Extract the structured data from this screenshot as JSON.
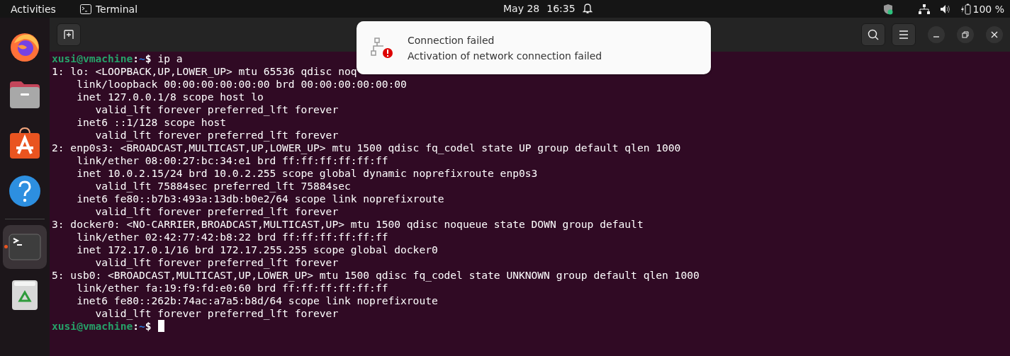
{
  "top_bar": {
    "activities": "Activities",
    "app_name": "Terminal",
    "date": "May 28",
    "time": "16:35",
    "battery": "100 %"
  },
  "dock": [
    {
      "kind": "browser",
      "running": false
    },
    {
      "kind": "files",
      "running": false
    },
    {
      "kind": "store",
      "running": false
    },
    {
      "kind": "help",
      "running": false
    },
    {
      "kind": "terminal",
      "running": true
    },
    {
      "kind": "trash",
      "running": false
    }
  ],
  "terminal": {
    "lines": [
      {
        "kind": "prompt",
        "user_host": "xusi@vmachine",
        "separator": ":",
        "path": "~",
        "symbol": "$",
        "command": "ip a"
      },
      {
        "kind": "output",
        "text": "1: lo: <LOOPBACK,UP,LOWER_UP> mtu 65536 qdisc noq"
      },
      {
        "kind": "output",
        "text": "    link/loopback 00:00:00:00:00:00 brd 00:00:00:00:00:00"
      },
      {
        "kind": "output",
        "text": "    inet 127.0.0.1/8 scope host lo"
      },
      {
        "kind": "output",
        "text": "       valid_lft forever preferred_lft forever"
      },
      {
        "kind": "output",
        "text": "    inet6 ::1/128 scope host"
      },
      {
        "kind": "output",
        "text": "       valid_lft forever preferred_lft forever"
      },
      {
        "kind": "output",
        "text": "2: enp0s3: <BROADCAST,MULTICAST,UP,LOWER_UP> mtu 1500 qdisc fq_codel state UP group default qlen 1000"
      },
      {
        "kind": "output",
        "text": "    link/ether 08:00:27:bc:34:e1 brd ff:ff:ff:ff:ff:ff"
      },
      {
        "kind": "output",
        "text": "    inet 10.0.2.15/24 brd 10.0.2.255 scope global dynamic noprefixroute enp0s3"
      },
      {
        "kind": "output",
        "text": "       valid_lft 75884sec preferred_lft 75884sec"
      },
      {
        "kind": "output",
        "text": "    inet6 fe80::b7b3:493a:13db:b0e2/64 scope link noprefixroute"
      },
      {
        "kind": "output",
        "text": "       valid_lft forever preferred_lft forever"
      },
      {
        "kind": "output",
        "text": "3: docker0: <NO-CARRIER,BROADCAST,MULTICAST,UP> mtu 1500 qdisc noqueue state DOWN group default"
      },
      {
        "kind": "output",
        "text": "    link/ether 02:42:77:42:b8:22 brd ff:ff:ff:ff:ff:ff"
      },
      {
        "kind": "output",
        "text": "    inet 172.17.0.1/16 brd 172.17.255.255 scope global docker0"
      },
      {
        "kind": "output",
        "text": "       valid_lft forever preferred_lft forever"
      },
      {
        "kind": "output",
        "text": "5: usb0: <BROADCAST,MULTICAST,UP,LOWER_UP> mtu 1500 qdisc fq_codel state UNKNOWN group default qlen 1000"
      },
      {
        "kind": "output",
        "text": "    link/ether fa:19:f9:fd:e0:60 brd ff:ff:ff:ff:ff:ff"
      },
      {
        "kind": "output",
        "text": "    inet6 fe80::262b:74ac:a7a5:b8d/64 scope link noprefixroute"
      },
      {
        "kind": "output",
        "text": "       valid_lft forever preferred_lft forever"
      },
      {
        "kind": "prompt",
        "user_host": "xusi@vmachine",
        "separator": ":",
        "path": "~",
        "symbol": "$"
      }
    ]
  },
  "notification": {
    "title": "Connection failed",
    "body": "Activation of network connection failed"
  }
}
